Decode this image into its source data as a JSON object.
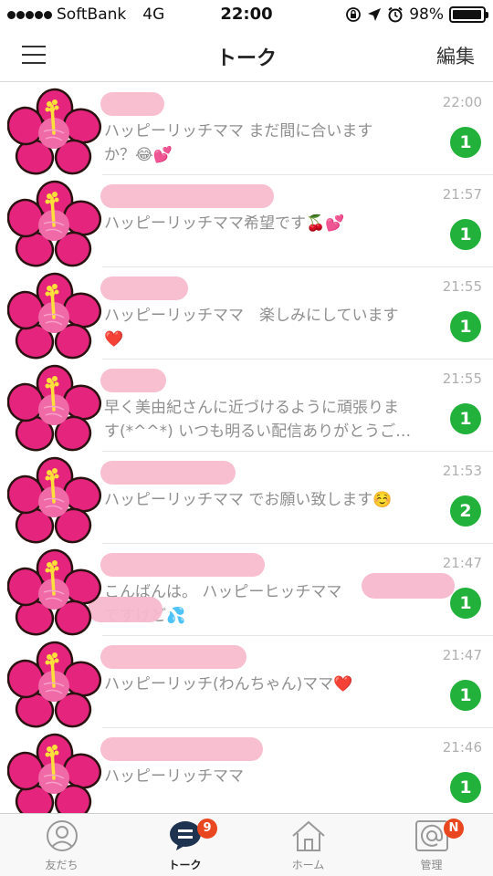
{
  "status_bar": {
    "carrier": "SoftBank",
    "network": "4G",
    "time": "22:00",
    "battery": "98%",
    "battery_level": 0.98
  },
  "nav": {
    "title": "トーク",
    "edit_label": "編集"
  },
  "chats": [
    {
      "time": "22:00",
      "message": "ハッピーリッチママ まだ間に合います\nか？😂💕",
      "unread": "1"
    },
    {
      "time": "21:57",
      "message": "ハッピーリッチママ希望です🍒💕",
      "unread": "1"
    },
    {
      "time": "21:55",
      "message": "ハッピーリッチママ　楽しみにしています\n❤️",
      "unread": "1"
    },
    {
      "time": "21:55",
      "message": "早く美由紀さんに近づけるように頑張りま\nす(*^^*) いつも明るい配信ありがとうご…",
      "unread": "1"
    },
    {
      "time": "21:53",
      "message": "ハッピーリッチママ でお願い致します☺️",
      "unread": "2"
    },
    {
      "time": "21:47",
      "message": "こんばんは。 ハッピーヒッチママ\nですけど💦",
      "unread": "1"
    },
    {
      "time": "21:47",
      "message": "ハッピーリッチ(わんちゃん)ママ❤️",
      "unread": "1"
    },
    {
      "time": "21:46",
      "message": "ハッピーリッチママ",
      "unread": "1"
    }
  ],
  "tabs": [
    {
      "label": "友だち",
      "icon": "person-icon"
    },
    {
      "label": "トーク",
      "icon": "chat-bubble-icon",
      "badge": "9"
    },
    {
      "label": "ホーム",
      "icon": "house-icon"
    },
    {
      "label": "管理",
      "icon": "at-icon",
      "badge": "N"
    }
  ],
  "colors": {
    "badge_green": "#22b13a",
    "tab_badge_red": "#e8471f",
    "flower_pink": "#e5247e",
    "blur_pink": "#f7b8cc"
  }
}
